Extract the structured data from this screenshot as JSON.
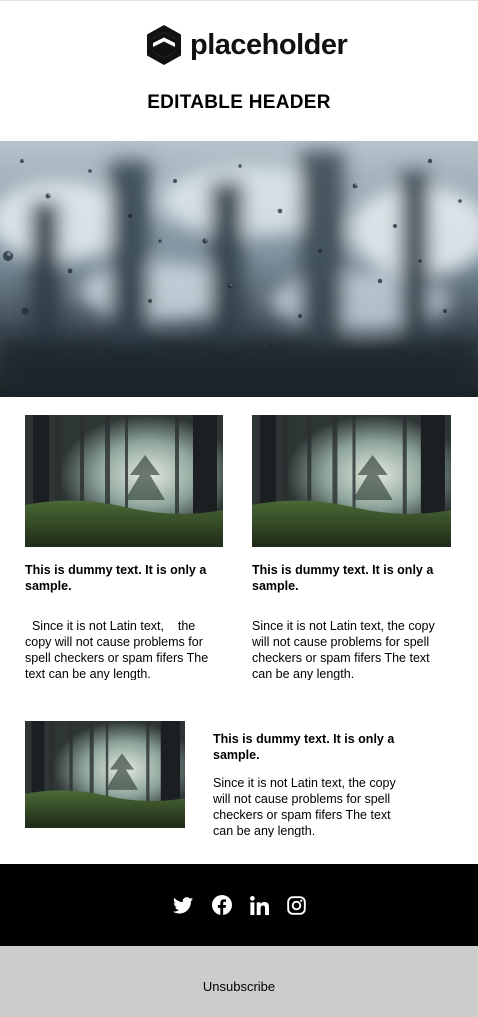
{
  "brand": {
    "logo_text": "placeholder",
    "logo_icon": "hexagon-logo-icon"
  },
  "header": {
    "title": "EDITABLE HEADER"
  },
  "images": {
    "hero": "rain-on-window-photo",
    "thumbnail": "misty-forest-photo"
  },
  "columns": [
    {
      "title": "This is dummy text. It is only a sample.",
      "body": "  Since it is not Latin text,    the copy will not cause problems for spell checkers or spam fifers The text can be any length."
    },
    {
      "title": "This is dummy text. It is only a sample.",
      "body": "Since it is not Latin text, the copy will not cause problems for spell checkers or spam fifers The text can be any length."
    }
  ],
  "feature_row": {
    "title": "This is dummy text. It is only a sample.",
    "body": "Since it is not Latin text, the copy will not cause problems for spell checkers or spam fifers The text can be any length."
  },
  "social": [
    {
      "icon": "twitter-icon"
    },
    {
      "icon": "facebook-icon"
    },
    {
      "icon": "linkedin-icon"
    },
    {
      "icon": "instagram-icon"
    }
  ],
  "footer": {
    "unsubscribe_label": "Unsubscribe"
  },
  "colors": {
    "social_bar_bg": "#000000",
    "footer_bg": "#cccccc",
    "text": "#000000"
  }
}
